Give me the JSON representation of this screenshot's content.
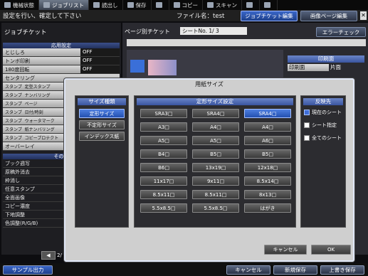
{
  "tabs": [
    {
      "label": "機械状態",
      "icon": "monitor-icon"
    },
    {
      "label": "ジョブリスト",
      "icon": "list-icon",
      "active": true
    },
    {
      "label": "読出し",
      "icon": "folder-icon"
    },
    {
      "label": "保存",
      "icon": "save-icon"
    },
    {
      "label": "",
      "icon": "globe-icon"
    },
    {
      "label": "コピー",
      "icon": "copy-icon"
    },
    {
      "label": "スキャン",
      "icon": "scan-icon"
    },
    {
      "label": "",
      "icon": "network-icon"
    },
    {
      "label": "",
      "icon": "settings-icon"
    }
  ],
  "header": {
    "message": "設定を行い、確定して下さい",
    "filename": "ファイル名：test",
    "edit_ticket": "ジョブチケット編集",
    "edit_page": "画像ページ編集"
  },
  "left": {
    "title": "ジョブチケット",
    "section1": "応用設定",
    "items1": [
      {
        "label": "とじしろ",
        "value": "OFF"
      },
      {
        "label": "トンボ印刷",
        "value": "OFF"
      },
      {
        "label": "180度回転",
        "value": "OFF"
      },
      {
        "label": "センタリング",
        "value": ""
      }
    ],
    "stamp_rows": [
      [
        "スタンプ",
        "定型スタンプ"
      ],
      [
        "スタンプ",
        "ナンバリング"
      ],
      [
        "スタンプ",
        "ページ"
      ],
      [
        "スタンプ",
        "日付/時刻"
      ],
      [
        "スタンプ",
        "ウォータマーク"
      ],
      [
        "スタンプ",
        "紙ナンバリング"
      ],
      [
        "スタンプ",
        "コピープロテクト"
      ]
    ],
    "overlay": "オーバーレイ",
    "section2": "その他",
    "items2": [
      "ブック週写",
      "原稿外消去",
      "枠消し",
      "任意スタンプ",
      "全面画像",
      "コピー濃度",
      "下地調整",
      "色調整(R/G/B)"
    ],
    "page_indicator": "2/"
  },
  "right": {
    "page_label": "ページ別チケット",
    "sheet_select": "シートNo.        1/     3",
    "error_check": "エラーチェック",
    "print_area_head": "印刷面",
    "print_area_label": "印刷面",
    "print_area_value": "片面"
  },
  "dialog": {
    "title": "用紙サイズ",
    "type_head": "サイズ種類",
    "types": [
      "定形サイズ",
      "不定形サイズ",
      "インデックス紙"
    ],
    "fixed_head": "定形サイズ設定",
    "sizes": [
      [
        "SRA3□",
        "SRA4□",
        "SRA4□"
      ],
      [
        "A3□",
        "A4□",
        "A4□"
      ],
      [
        "A5□",
        "A5□",
        "A6□"
      ],
      [
        "B4□",
        "B5□",
        "B5□"
      ],
      [
        "B6□",
        "13x19□",
        "12x18□"
      ],
      [
        "11x17□",
        "9x11□",
        "8.5x14□"
      ],
      [
        "8.5x11□",
        "8.5x11□",
        "8x13□"
      ],
      [
        "5.5x8.5□",
        "5.5x8.5□",
        "はがき"
      ]
    ],
    "apply_head": "反映先",
    "apply": [
      "現在のシート",
      "シート指定",
      "全てのシート"
    ],
    "cancel": "キャンセル",
    "ok": "OK"
  },
  "bottom": {
    "sample": "サンプル出力",
    "cancel": "キャンセル",
    "save_new": "新規保存",
    "save_over": "上書き保存"
  }
}
